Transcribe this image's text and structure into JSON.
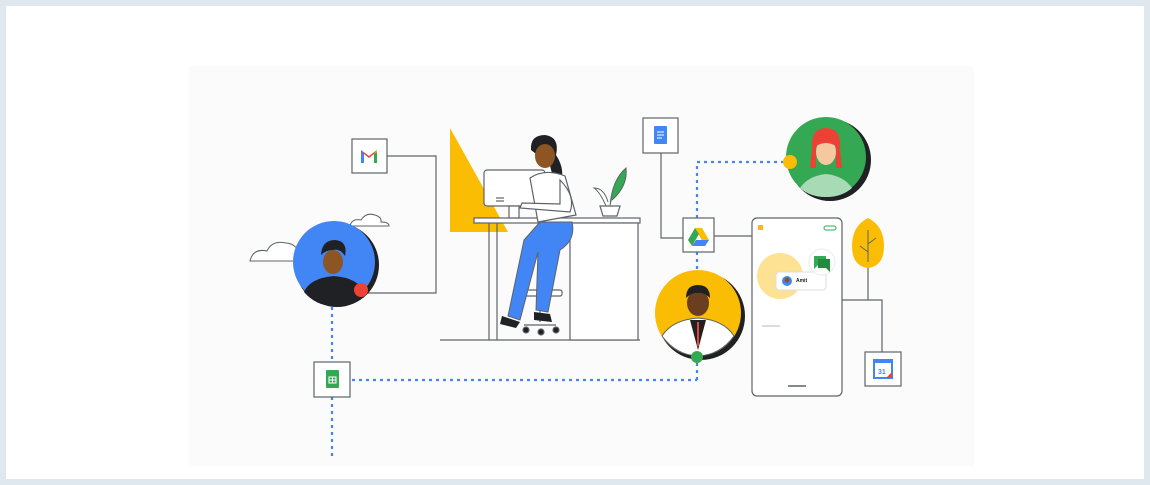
{
  "illustration": {
    "chat_name": "Amit",
    "calendar_day": "31"
  },
  "colors": {
    "background": "#dfe8ee",
    "blue": "#4285f4",
    "green": "#34a853",
    "yellow": "#fbbc04",
    "red": "#ea4335",
    "line": "#5f6368",
    "dotted": "#4285f4"
  },
  "icons": [
    "gmail-icon",
    "docs-icon",
    "drive-icon",
    "sheets-icon",
    "chat-icon",
    "calendar-icon"
  ]
}
